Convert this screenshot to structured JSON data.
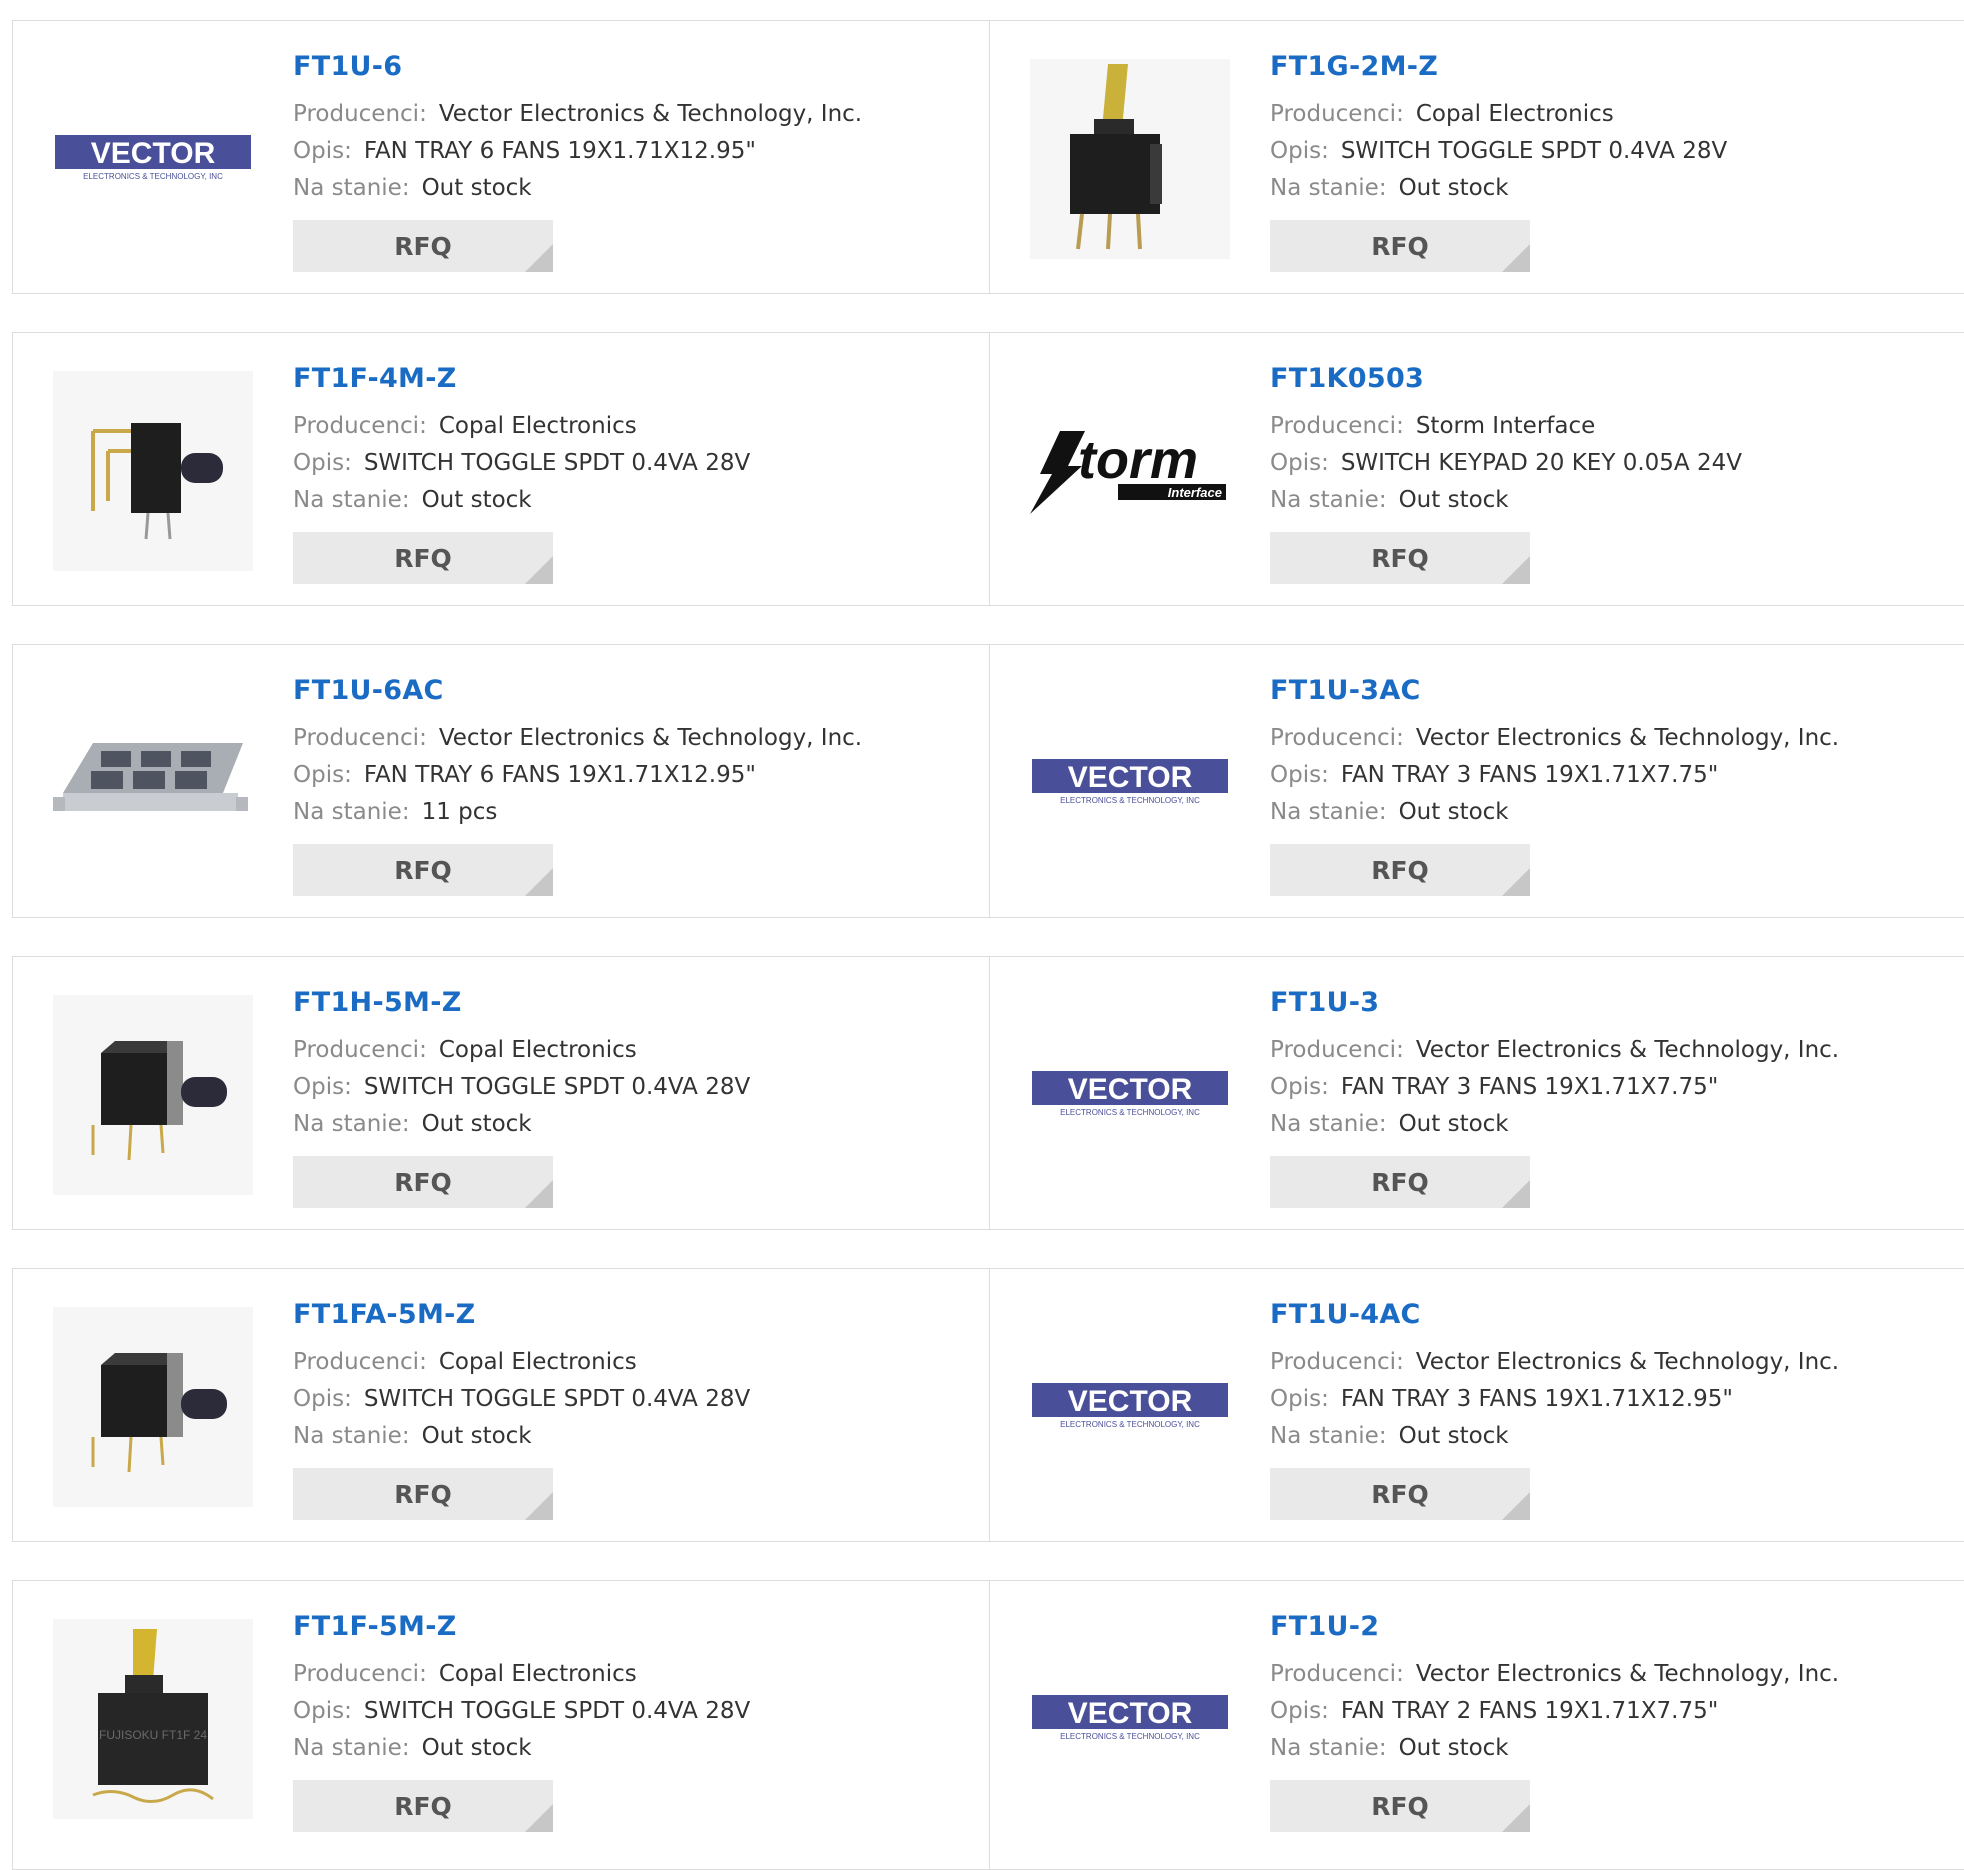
{
  "labels": {
    "manufacturer": "Producenci:",
    "description": "Opis:",
    "stock": "Na stanie:",
    "rfq": "RFQ"
  },
  "products": [
    {
      "part": "FT1U-6",
      "manufacturer": "Vector Electronics & Technology, Inc.",
      "description": "FAN TRAY 6 FANS 19X1.71X12.95\"",
      "stock": "Out stock",
      "image": "vector-logo"
    },
    {
      "part": "FT1G-2M-Z",
      "manufacturer": "Copal Electronics",
      "description": "SWITCH TOGGLE SPDT 0.4VA 28V",
      "stock": "Out stock",
      "image": "toggle-switch-vertical"
    },
    {
      "part": "FT1F-4M-Z",
      "manufacturer": "Copal Electronics",
      "description": "SWITCH TOGGLE SPDT 0.4VA 28V",
      "stock": "Out stock",
      "image": "toggle-switch-right-angle"
    },
    {
      "part": "FT1K0503",
      "manufacturer": "Storm Interface",
      "description": "SWITCH KEYPAD 20 KEY 0.05A 24V",
      "stock": "Out stock",
      "image": "storm-logo"
    },
    {
      "part": "FT1U-6AC",
      "manufacturer": "Vector Electronics & Technology, Inc.",
      "description": "FAN TRAY 6 FANS 19X1.71X12.95\"",
      "stock": "11 pcs",
      "image": "fan-tray"
    },
    {
      "part": "FT1U-3AC",
      "manufacturer": "Vector Electronics & Technology, Inc.",
      "description": "FAN TRAY 3 FANS 19X1.71X7.75\"",
      "stock": "Out stock",
      "image": "vector-logo"
    },
    {
      "part": "FT1H-5M-Z",
      "manufacturer": "Copal Electronics",
      "description": "SWITCH TOGGLE SPDT 0.4VA 28V",
      "stock": "Out stock",
      "image": "toggle-switch-horizontal"
    },
    {
      "part": "FT1U-3",
      "manufacturer": "Vector Electronics & Technology, Inc.",
      "description": "FAN TRAY 3 FANS 19X1.71X7.75\"",
      "stock": "Out stock",
      "image": "vector-logo"
    },
    {
      "part": "FT1FA-5M-Z",
      "manufacturer": "Copal Electronics",
      "description": "SWITCH TOGGLE SPDT 0.4VA 28V",
      "stock": "Out stock",
      "image": "toggle-switch-horizontal"
    },
    {
      "part": "FT1U-4AC",
      "manufacturer": "Vector Electronics & Technology, Inc.",
      "description": "FAN TRAY 3 FANS 19X1.71X12.95\"",
      "stock": "Out stock",
      "image": "vector-logo"
    },
    {
      "part": "FT1F-5M-Z",
      "manufacturer": "Copal Electronics",
      "description": "SWITCH TOGGLE SPDT 0.4VA 28V",
      "stock": "Out stock",
      "image": "toggle-switch-yellow"
    },
    {
      "part": "FT1U-2",
      "manufacturer": "Vector Electronics & Technology, Inc.",
      "description": "FAN TRAY 2 FANS 19X1.71X7.75\"",
      "stock": "Out stock",
      "image": "vector-logo"
    }
  ],
  "logos": {
    "vector_word": "VECTOR",
    "vector_sub": "ELECTRONICS & TECHNOLOGY, INC",
    "storm_word": "torm",
    "storm_sub": "Interface",
    "toggle_marking": "FUJISOKU FT1F 24"
  },
  "colors": {
    "link": "#1a6bc4",
    "label": "#8a8a8a",
    "value": "#333333",
    "border": "#dddddd",
    "button_bg": "#e9e9e9",
    "button_corner": "#c7c7c7",
    "vector_logo": "#4a4f9a"
  }
}
